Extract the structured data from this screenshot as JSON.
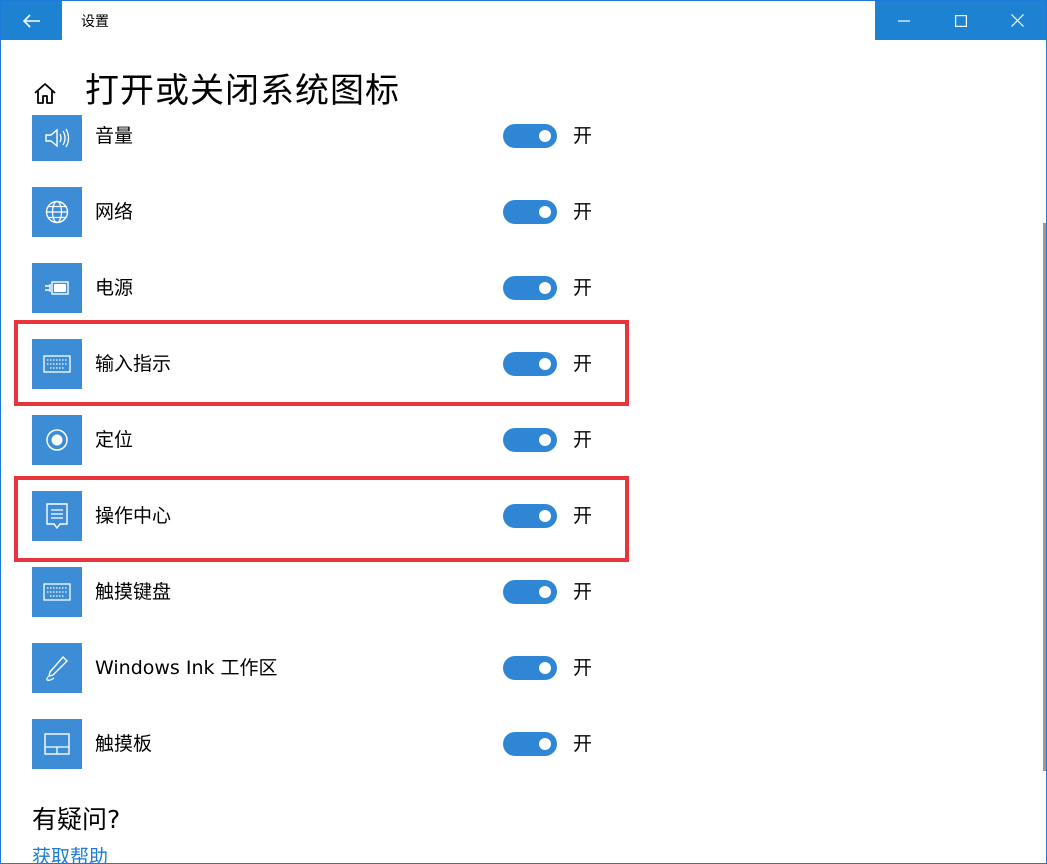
{
  "window": {
    "title": "设置",
    "accent_color": "#1e82d2"
  },
  "header": {
    "page_title": "打开或关闭系统图标"
  },
  "icons": {
    "back": "back-arrow-icon",
    "home": "home-icon",
    "minimize": "minimize-icon",
    "maximize": "maximize-icon",
    "close": "close-icon"
  },
  "items": [
    {
      "label": "音量",
      "icon": "volume-icon",
      "state": "开",
      "on": true
    },
    {
      "label": "网络",
      "icon": "network-globe-icon",
      "state": "开",
      "on": true
    },
    {
      "label": "电源",
      "icon": "battery-power-icon",
      "state": "开",
      "on": true
    },
    {
      "label": "输入指示",
      "icon": "keyboard-icon",
      "state": "开",
      "on": true,
      "highlighted": true
    },
    {
      "label": "定位",
      "icon": "location-icon",
      "state": "开",
      "on": true
    },
    {
      "label": "操作中心",
      "icon": "action-center-icon",
      "state": "开",
      "on": true,
      "highlighted": true
    },
    {
      "label": "触摸键盘",
      "icon": "touch-keyboard-icon",
      "state": "开",
      "on": true
    },
    {
      "label": "Windows Ink 工作区",
      "icon": "pen-ink-icon",
      "state": "开",
      "on": true
    },
    {
      "label": "触摸板",
      "icon": "touchpad-icon",
      "state": "开",
      "on": true
    }
  ],
  "help": {
    "title": "有疑问?",
    "link": "获取帮助"
  },
  "colors": {
    "tile": "#3c8cd6",
    "toggle_on": "#2f86d4",
    "highlight": "#e8353d",
    "link": "#1e7ad6"
  }
}
